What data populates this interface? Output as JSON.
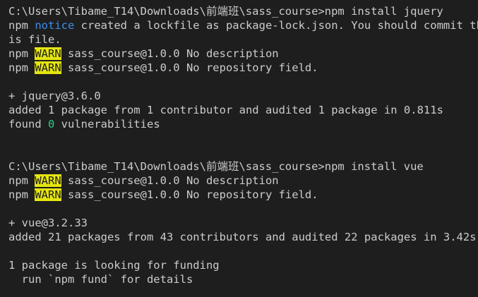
{
  "colors": {
    "background": "#1e1e1e",
    "text": "#cccccc",
    "notice": "#3b8eea",
    "warn_bg": "#e5e510",
    "warn_fg": "#1e1e1e",
    "zero": "#23d18b"
  },
  "block1": {
    "prompt": "C:\\Users\\Tibame_T14\\Downloads\\前端班\\sass_course>npm install jquery",
    "notice_npm": "npm ",
    "notice_tag": "notice",
    "notice_msg_1": " created a lockfile as package-lock.json. You should commit th",
    "notice_msg_2": "is file.",
    "warn1_npm": "npm ",
    "warn1_tag": "WARN",
    "warn1_msg": " sass_course@1.0.0 No description",
    "warn2_npm": "npm ",
    "warn2_tag": "WARN",
    "warn2_msg": " sass_course@1.0.0 No repository field.",
    "pkg": "+ jquery@3.6.0",
    "added": "added 1 package from 1 contributor and audited 1 package in 0.811s",
    "found_pre": "found ",
    "found_zero": "0",
    "found_post": " vulnerabilities"
  },
  "block2": {
    "prompt": "C:\\Users\\Tibame_T14\\Downloads\\前端班\\sass_course>npm install vue",
    "warn1_npm": "npm ",
    "warn1_tag": "WARN",
    "warn1_msg": " sass_course@1.0.0 No description",
    "warn2_npm": "npm ",
    "warn2_tag": "WARN",
    "warn2_msg": " sass_course@1.0.0 No repository field.",
    "pkg": "+ vue@3.2.33",
    "added": "added 21 packages from 43 contributors and audited 22 packages in 3.42s",
    "funding_1": "1 package is looking for funding",
    "funding_2": "  run `npm fund` for details"
  }
}
